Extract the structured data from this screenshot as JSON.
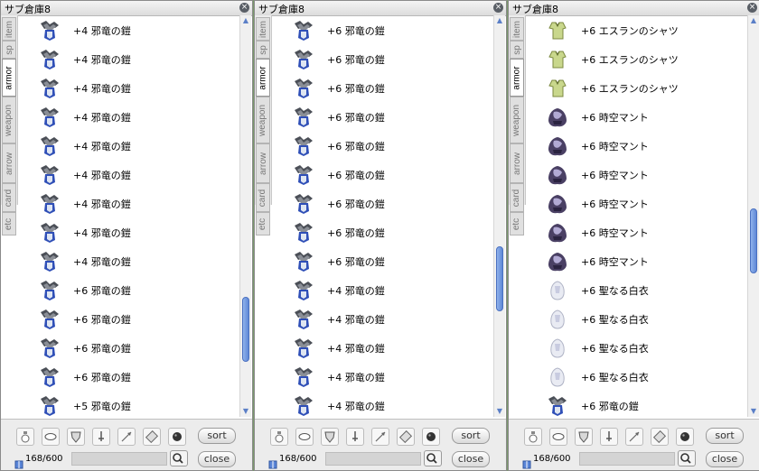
{
  "windows": [
    {
      "title": "サブ倉庫8",
      "tabs": [
        "item",
        "sp",
        "armor",
        "weapon",
        "arrow",
        "card",
        "etc"
      ],
      "active_tab": "armor",
      "items": [
        {
          "label": "+4 邪竜の鎧",
          "icon": "dragon-armor"
        },
        {
          "label": "+4 邪竜の鎧",
          "icon": "dragon-armor"
        },
        {
          "label": "+4 邪竜の鎧",
          "icon": "dragon-armor"
        },
        {
          "label": "+4 邪竜の鎧",
          "icon": "dragon-armor"
        },
        {
          "label": "+4 邪竜の鎧",
          "icon": "dragon-armor"
        },
        {
          "label": "+4 邪竜の鎧",
          "icon": "dragon-armor"
        },
        {
          "label": "+4 邪竜の鎧",
          "icon": "dragon-armor"
        },
        {
          "label": "+4 邪竜の鎧",
          "icon": "dragon-armor"
        },
        {
          "label": "+4 邪竜の鎧",
          "icon": "dragon-armor"
        },
        {
          "label": "+6 邪竜の鎧",
          "icon": "dragon-armor"
        },
        {
          "label": "+6 邪竜の鎧",
          "icon": "dragon-armor"
        },
        {
          "label": "+6 邪竜の鎧",
          "icon": "dragon-armor"
        },
        {
          "label": "+6 邪竜の鎧",
          "icon": "dragon-armor"
        },
        {
          "label": "+5 邪竜の鎧",
          "icon": "dragon-armor"
        }
      ],
      "scroll_position": 0.86,
      "scroll_visible_fraction": 0.17,
      "sort_label": "sort",
      "close_label": "close",
      "count_text": "168/600"
    },
    {
      "title": "サブ倉庫8",
      "tabs": [
        "item",
        "sp",
        "armor",
        "weapon",
        "arrow",
        "card",
        "etc"
      ],
      "active_tab": "armor",
      "items": [
        {
          "label": "+6 邪竜の鎧",
          "icon": "dragon-armor"
        },
        {
          "label": "+6 邪竜の鎧",
          "icon": "dragon-armor"
        },
        {
          "label": "+6 邪竜の鎧",
          "icon": "dragon-armor"
        },
        {
          "label": "+6 邪竜の鎧",
          "icon": "dragon-armor"
        },
        {
          "label": "+6 邪竜の鎧",
          "icon": "dragon-armor"
        },
        {
          "label": "+6 邪竜の鎧",
          "icon": "dragon-armor"
        },
        {
          "label": "+6 邪竜の鎧",
          "icon": "dragon-armor"
        },
        {
          "label": "+6 邪竜の鎧",
          "icon": "dragon-armor"
        },
        {
          "label": "+6 邪竜の鎧",
          "icon": "dragon-armor"
        },
        {
          "label": "+4 邪竜の鎧",
          "icon": "dragon-armor"
        },
        {
          "label": "+4 邪竜の鎧",
          "icon": "dragon-armor"
        },
        {
          "label": "+4 邪竜の鎧",
          "icon": "dragon-armor"
        },
        {
          "label": "+4 邪竜の鎧",
          "icon": "dragon-armor"
        },
        {
          "label": "+4 邪竜の鎧",
          "icon": "dragon-armor"
        }
      ],
      "scroll_position": 0.7,
      "scroll_visible_fraction": 0.17,
      "sort_label": "sort",
      "close_label": "close",
      "count_text": "168/600"
    },
    {
      "title": "サブ倉庫8",
      "tabs": [
        "item",
        "sp",
        "armor",
        "weapon",
        "arrow",
        "card",
        "etc"
      ],
      "active_tab": "armor",
      "items": [
        {
          "label": "+6 エスランのシャツ",
          "icon": "shirt"
        },
        {
          "label": "+6 エスランのシャツ",
          "icon": "shirt"
        },
        {
          "label": "+6 エスランのシャツ",
          "icon": "shirt"
        },
        {
          "label": "+6 時空マント",
          "icon": "cloak"
        },
        {
          "label": "+6 時空マント",
          "icon": "cloak"
        },
        {
          "label": "+6 時空マント",
          "icon": "cloak"
        },
        {
          "label": "+6 時空マント",
          "icon": "cloak"
        },
        {
          "label": "+6 時空マント",
          "icon": "cloak"
        },
        {
          "label": "+6 時空マント",
          "icon": "cloak"
        },
        {
          "label": "+6 聖なる白衣",
          "icon": "white-robe"
        },
        {
          "label": "+6 聖なる白衣",
          "icon": "white-robe"
        },
        {
          "label": "+6 聖なる白衣",
          "icon": "white-robe"
        },
        {
          "label": "+6 聖なる白衣",
          "icon": "white-robe"
        },
        {
          "label": "+6 邪竜の鎧",
          "icon": "dragon-armor"
        }
      ],
      "scroll_position": 0.58,
      "scroll_visible_fraction": 0.17,
      "sort_label": "sort",
      "close_label": "close",
      "count_text": "168/600"
    }
  ],
  "filter_icons": [
    "potion-icon",
    "oval-icon",
    "shield-icon",
    "sword-icon",
    "arrow-icon",
    "card-icon",
    "bomb-icon"
  ],
  "colors": {
    "scroll_thumb": "#6f97de",
    "window_bg": "#ffffff",
    "footer_bg": "#ececec"
  }
}
